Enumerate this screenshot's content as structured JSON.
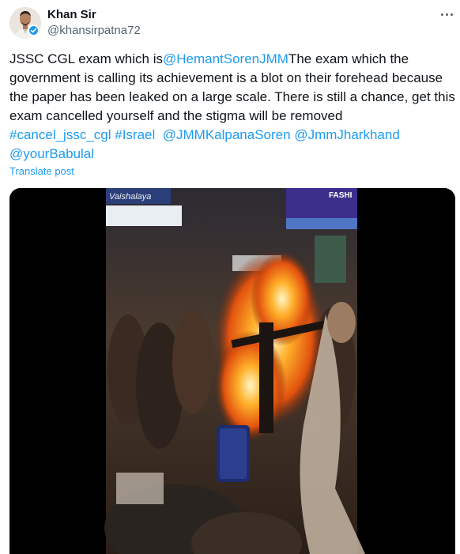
{
  "author": {
    "name": "Khan Sir",
    "handle": "@khansirpatna72",
    "verified": true
  },
  "tweet": {
    "text_parts": [
      {
        "text": "JSSC CGL exam which is",
        "link": false
      },
      {
        "text": "@HemantSorenJMM",
        "link": true
      },
      {
        "text": "The exam which the government is calling its achievement is a blot on their forehead because the paper has been leaked on a large scale. There is still a chance, get this exam cancelled yourself and the stigma will be removed",
        "link": false
      },
      {
        "text": "#cancel_jssc_cgl",
        "link": true
      },
      {
        "text": "#Israel",
        "link": true
      },
      {
        "text": "@JMMKalpanaSoren",
        "link": true
      },
      {
        "text": "@JmmJharkhand",
        "link": true
      },
      {
        "text": "@yourBabulal",
        "link": true
      }
    ],
    "translate_label": "Translate post"
  },
  "media": {
    "type": "video",
    "sign_left": "Vaishalaya",
    "sign_right": "FASHI"
  },
  "colors": {
    "link": "#1d9bf0",
    "secondary_text": "#536471",
    "primary_text": "#0f1419"
  }
}
